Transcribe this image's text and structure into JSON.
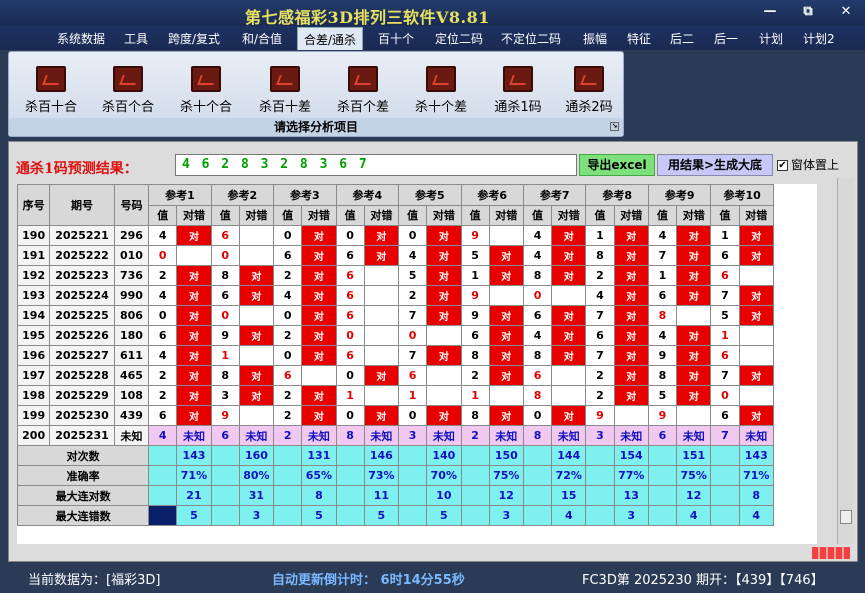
{
  "app": {
    "title": "第七感福彩3D排列三软件V8.81"
  },
  "menu": [
    "系统数据",
    "工具",
    "跨度/复式",
    "和/合值",
    "合差/通杀",
    "百十个",
    "定位二码",
    "不定位二码",
    "振幅",
    "特征",
    "后二",
    "后一",
    "计划",
    "计划2"
  ],
  "menu_active": "合差/通杀",
  "ribbon": {
    "buttons": [
      "杀百十合",
      "杀百个合",
      "杀十个合",
      "杀百十差",
      "杀百个差",
      "杀十个差",
      "通杀1码",
      "通杀2码"
    ],
    "caption": "请选择分析项目"
  },
  "prediction": {
    "label": "通杀1码预测结果：",
    "value": "4 6 2 8 3 2 8 3 6 7"
  },
  "buttons": {
    "excel": "导出excel",
    "generate": "用结果>生成大底",
    "topmost": "窗体置上",
    "topmost_checked": true
  },
  "table": {
    "h_seq": "序号",
    "h_period": "期号",
    "h_num": "号码",
    "refs": [
      "参考1",
      "参考2",
      "参考3",
      "参考4",
      "参考5",
      "参考6",
      "参考7",
      "参考8",
      "参考9",
      "参考10"
    ],
    "sub_val": "值",
    "sub_res": "对错",
    "correct_mark": "对",
    "rows": [
      {
        "seq": "190",
        "period": "2025221",
        "num": "296",
        "vals": [
          "4",
          "6",
          "0",
          "0",
          "0",
          "9",
          "4",
          "1",
          "4",
          "1"
        ],
        "res": [
          1,
          0,
          1,
          1,
          1,
          0,
          1,
          1,
          1,
          1
        ]
      },
      {
        "seq": "191",
        "period": "2025222",
        "num": "010",
        "vals": [
          "0",
          "0",
          "6",
          "6",
          "4",
          "5",
          "4",
          "8",
          "7",
          "6"
        ],
        "res": [
          0,
          0,
          1,
          1,
          1,
          1,
          1,
          1,
          1,
          1
        ]
      },
      {
        "seq": "192",
        "period": "2025223",
        "num": "736",
        "vals": [
          "2",
          "8",
          "2",
          "6",
          "5",
          "1",
          "8",
          "2",
          "1",
          "6"
        ],
        "res": [
          1,
          1,
          1,
          0,
          1,
          1,
          1,
          1,
          1,
          0
        ]
      },
      {
        "seq": "193",
        "period": "2025224",
        "num": "990",
        "vals": [
          "4",
          "6",
          "4",
          "6",
          "2",
          "9",
          "0",
          "4",
          "6",
          "7"
        ],
        "res": [
          1,
          1,
          1,
          0,
          1,
          0,
          0,
          1,
          1,
          1
        ]
      },
      {
        "seq": "194",
        "period": "2025225",
        "num": "806",
        "vals": [
          "0",
          "0",
          "0",
          "6",
          "7",
          "9",
          "6",
          "7",
          "8",
          "5"
        ],
        "res": [
          1,
          0,
          1,
          0,
          1,
          1,
          1,
          1,
          0,
          1
        ]
      },
      {
        "seq": "195",
        "period": "2025226",
        "num": "180",
        "vals": [
          "6",
          "9",
          "2",
          "0",
          "0",
          "6",
          "4",
          "6",
          "4",
          "1"
        ],
        "res": [
          1,
          1,
          1,
          0,
          0,
          1,
          1,
          1,
          1,
          0
        ]
      },
      {
        "seq": "196",
        "period": "2025227",
        "num": "611",
        "vals": [
          "4",
          "1",
          "0",
          "6",
          "7",
          "8",
          "8",
          "7",
          "9",
          "6"
        ],
        "res": [
          1,
          0,
          1,
          0,
          1,
          1,
          1,
          1,
          1,
          0
        ]
      },
      {
        "seq": "197",
        "period": "2025228",
        "num": "465",
        "vals": [
          "2",
          "8",
          "6",
          "0",
          "6",
          "2",
          "6",
          "2",
          "8",
          "7"
        ],
        "res": [
          1,
          1,
          0,
          1,
          0,
          1,
          0,
          1,
          1,
          1
        ]
      },
      {
        "seq": "198",
        "period": "2025229",
        "num": "108",
        "vals": [
          "2",
          "3",
          "2",
          "1",
          "1",
          "1",
          "8",
          "2",
          "5",
          "0"
        ],
        "res": [
          1,
          1,
          1,
          0,
          0,
          0,
          0,
          1,
          1,
          0
        ]
      },
      {
        "seq": "199",
        "period": "2025230",
        "num": "439",
        "vals": [
          "6",
          "9",
          "2",
          "0",
          "0",
          "8",
          "0",
          "9",
          "9",
          "6"
        ],
        "res": [
          1,
          0,
          1,
          1,
          1,
          1,
          1,
          0,
          0,
          1
        ]
      }
    ],
    "last_row": {
      "seq": "200",
      "period": "2025231",
      "num": "未知",
      "vals": [
        "4",
        "6",
        "2",
        "8",
        "3",
        "2",
        "8",
        "3",
        "6",
        "7"
      ],
      "res_label": "未知"
    },
    "stats": [
      {
        "label": "对次数",
        "values": [
          "143",
          "160",
          "131",
          "146",
          "140",
          "150",
          "144",
          "154",
          "151",
          "143"
        ]
      },
      {
        "label": "准确率",
        "values": [
          "71%",
          "80%",
          "65%",
          "73%",
          "70%",
          "75%",
          "72%",
          "77%",
          "75%",
          "71%"
        ]
      },
      {
        "label": "最大连对数",
        "values": [
          "21",
          "31",
          "8",
          "11",
          "10",
          "12",
          "15",
          "13",
          "12",
          "8"
        ]
      },
      {
        "label": "最大连错数",
        "values": [
          "5",
          "3",
          "5",
          "5",
          "5",
          "3",
          "4",
          "3",
          "4",
          "4"
        ]
      }
    ]
  },
  "status": {
    "current": "当前数据为：[福彩3D]",
    "countdown": "自动更新倒计时： 6时14分55秒",
    "draw": "FC3D第 2025230 期开：【439】【746】"
  },
  "colors": {
    "wrong_red_value": "#e00000",
    "correct_cell": "#e80000",
    "stat_bg": "#7ff0f0",
    "unknown_bg": "#f0c8f0"
  }
}
